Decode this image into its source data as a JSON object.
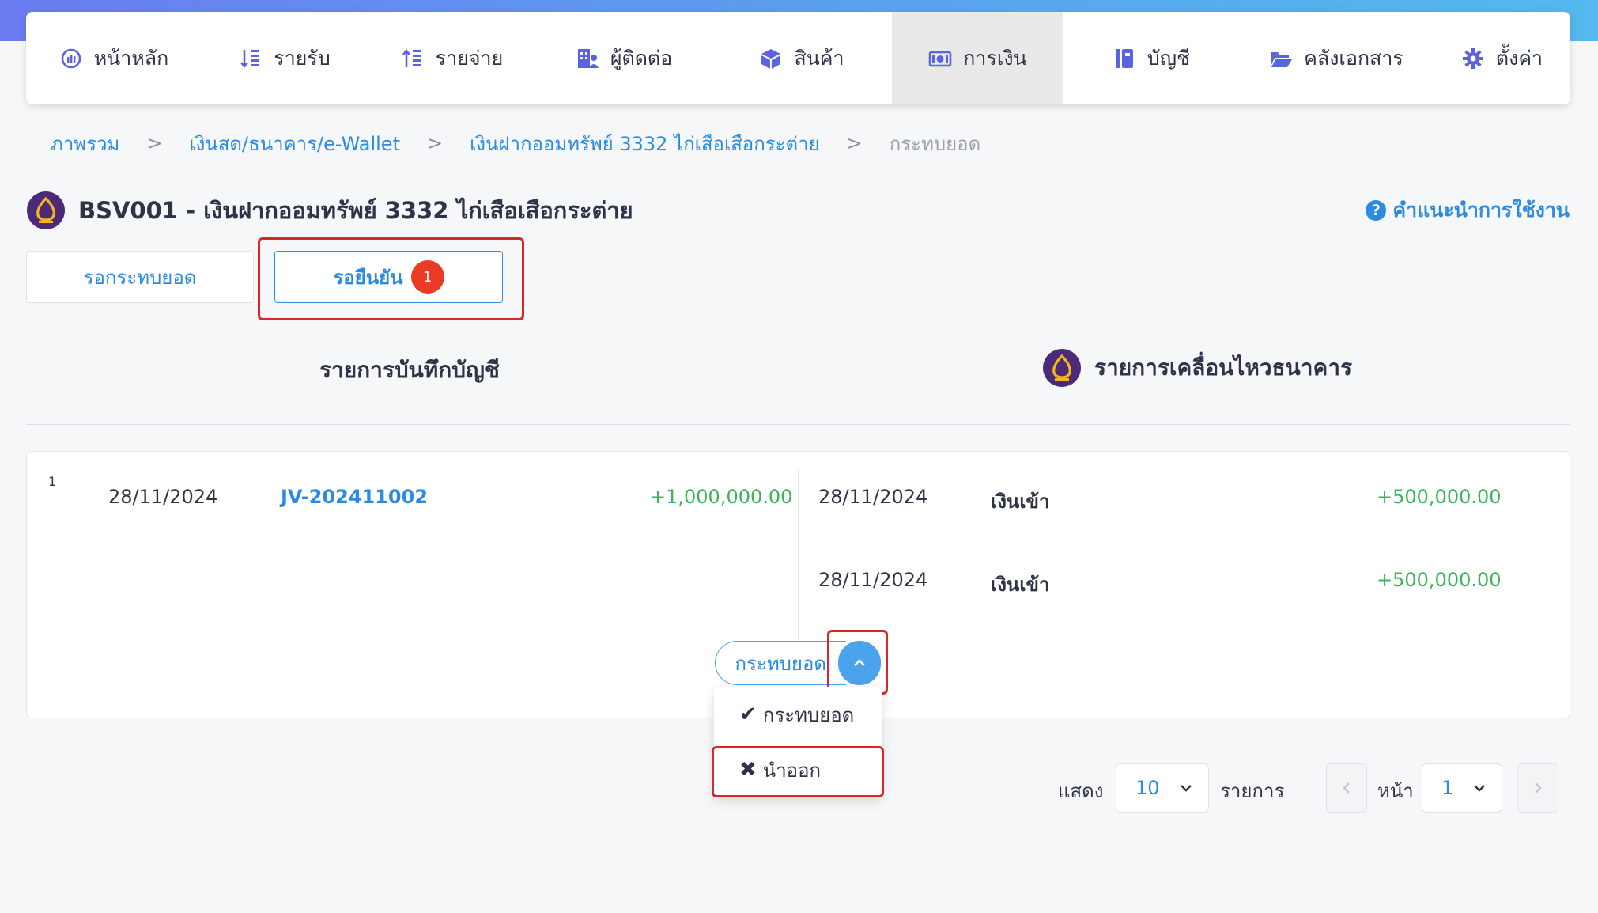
{
  "nav": {
    "items": [
      {
        "label": "หน้าหลัก",
        "icon": "dashboard-gauge-icon"
      },
      {
        "label": "รายรับ",
        "icon": "income-sort-icon"
      },
      {
        "label": "รายจ่าย",
        "icon": "expense-sort-icon"
      },
      {
        "label": "ผู้ติดต่อ",
        "icon": "contacts-building-icon"
      },
      {
        "label": "สินค้า",
        "icon": "box-icon"
      },
      {
        "label": "การเงิน",
        "icon": "money-icon"
      },
      {
        "label": "บัญชี",
        "icon": "ledger-book-icon"
      },
      {
        "label": "คลังเอกสาร",
        "icon": "folder-open-icon"
      },
      {
        "label": "ตั้งค่า",
        "icon": "gear-icon"
      }
    ],
    "active": "การเงิน"
  },
  "breadcrumb": {
    "items": [
      "ภาพรวม",
      "เงินสด/ธนาคาร/e-Wallet",
      "เงินฝากออมทรัพย์ 3332 ไก่เสือเสือกระต่าย"
    ],
    "current": "กระทบยอด",
    "separator": ">"
  },
  "header": {
    "title": "BSV001 - เงินฝากออมทรัพย์ 3332 ไก่เสือเสือกระต่าย",
    "help_icon": "?",
    "help_label": "คำแนะนำการใช้งาน"
  },
  "tabs": {
    "pending_label": "รอกระทบยอด",
    "confirm_label": "รอยืนยัน",
    "confirm_badge": "1"
  },
  "columns": {
    "left_title": "รายการบันทึกบัญชี",
    "right_title": "รายการเคลื่อนไหวธนาคาร"
  },
  "rows": [
    {
      "index": "1",
      "ledger": {
        "date": "28/11/2024",
        "doc": "JV-202411002",
        "amount": "+1,000,000.00"
      },
      "bank": [
        {
          "date": "28/11/2024",
          "desc": "เงินเข้า",
          "amount": "+500,000.00"
        },
        {
          "date": "28/11/2024",
          "desc": "เงินเข้า",
          "amount": "+500,000.00"
        }
      ]
    }
  ],
  "action": {
    "main_label": "กระทบยอด",
    "menu": [
      {
        "icon": "✔",
        "label": "กระทบยอด"
      },
      {
        "icon": "✖",
        "label": "นำออก"
      }
    ]
  },
  "pagination": {
    "show_label": "แสดง",
    "page_size": "10",
    "items_label": "รายการ",
    "page_label": "หน้า",
    "page": "1"
  },
  "colors": {
    "accent": "#2b8be3",
    "positive": "#3bb45a",
    "badge": "#ea3b26",
    "highlight": "#d62828",
    "bank_brand": "#4b2a7a"
  }
}
